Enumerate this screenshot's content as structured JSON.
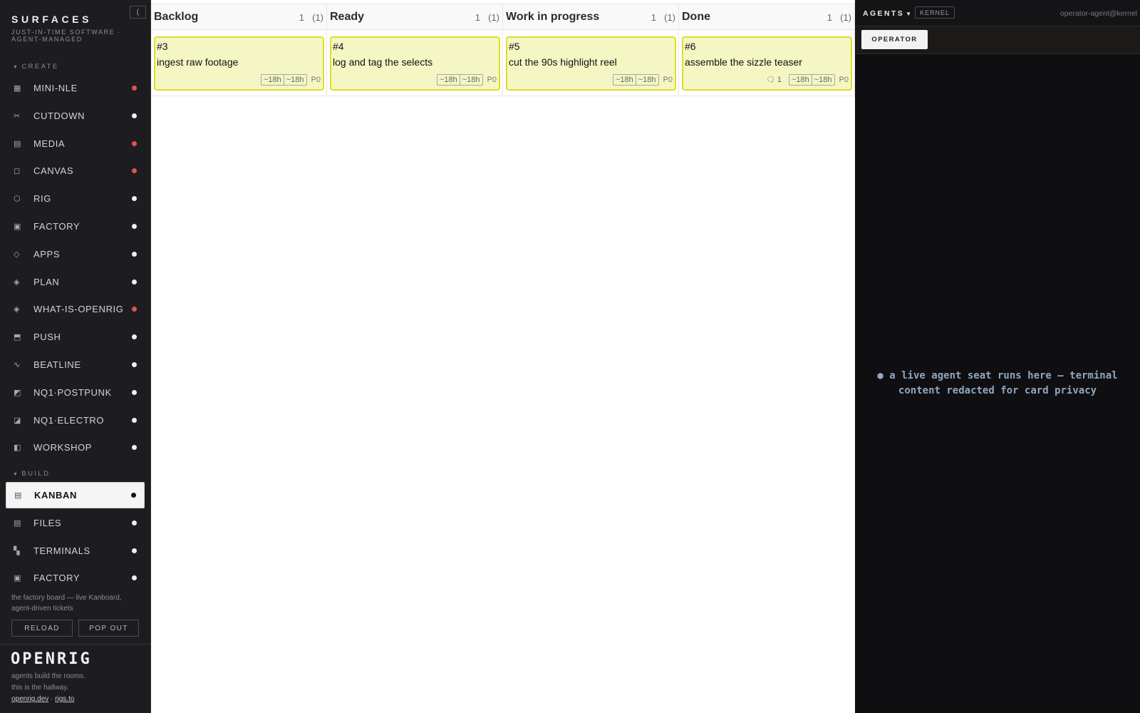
{
  "sidebar": {
    "collapse_icon": "(",
    "title": "SURFACES",
    "subtitle": "JUST-IN-TIME SOFTWARE · AGENT-MANAGED",
    "sections": {
      "create": {
        "label": "CREATE",
        "items": [
          {
            "label": "MINI-NLE",
            "icon": "▦",
            "icon_name": "grid-icon",
            "status": "red"
          },
          {
            "label": "CUTDOWN",
            "icon": "✂",
            "icon_name": "scissors-icon",
            "status": "white"
          },
          {
            "label": "MEDIA",
            "icon": "▤",
            "icon_name": "media-icon",
            "status": "red"
          },
          {
            "label": "CANVAS",
            "icon": "◻",
            "icon_name": "canvas-icon",
            "status": "red"
          },
          {
            "label": "RIG",
            "icon": "⬡",
            "icon_name": "hexagon-icon",
            "status": "white"
          },
          {
            "label": "FACTORY",
            "icon": "▣",
            "icon_name": "factory-icon",
            "status": "white"
          },
          {
            "label": "APPS",
            "icon": "◇",
            "icon_name": "diamond-icon",
            "status": "white"
          },
          {
            "label": "PLAN",
            "icon": "◈",
            "icon_name": "plan-icon",
            "status": "white"
          },
          {
            "label": "WHAT-IS-OPENRIG",
            "icon": "◈",
            "icon_name": "info-diamond-icon",
            "status": "red"
          },
          {
            "label": "PUSH",
            "icon": "⬒",
            "icon_name": "push-icon",
            "status": "white"
          },
          {
            "label": "BEATLINE",
            "icon": "∿",
            "icon_name": "wave-icon",
            "status": "white"
          },
          {
            "label": "NQ1·POSTPUNK",
            "icon": "◩",
            "icon_name": "postpunk-icon",
            "status": "white"
          },
          {
            "label": "NQ1·ELECTRO",
            "icon": "◪",
            "icon_name": "electro-icon",
            "status": "white"
          },
          {
            "label": "WORKSHOP",
            "icon": "◧",
            "icon_name": "workshop-icon",
            "status": "white"
          }
        ]
      },
      "build": {
        "label": "BUILD",
        "items": [
          {
            "label": "KANBAN",
            "icon": "▤",
            "icon_name": "kanban-icon",
            "status": "black",
            "active": true
          },
          {
            "label": "FILES",
            "icon": "▤",
            "icon_name": "files-icon",
            "status": "white"
          },
          {
            "label": "TERMINALS",
            "icon": "▚",
            "icon_name": "terminal-icon",
            "status": "white"
          },
          {
            "label": "FACTORY",
            "icon": "▣",
            "icon_name": "factory-icon",
            "status": "white"
          }
        ]
      }
    },
    "description": "the factory board — live Kanboard, agent-driven tickets",
    "reload_label": "RELOAD",
    "popout_label": "POP OUT",
    "logo": "OPENRIG",
    "tagline_1": "agents build the rooms.",
    "tagline_2": "this is the hallway.",
    "link_1": "openrig.dev",
    "link_sep": "·",
    "link_2": "rigs.to"
  },
  "colors": {
    "status_red": "#e5534b",
    "status_white": "#f0f0f0",
    "status_black": "#111111",
    "card_bg": "#f4f6c3",
    "card_border": "#dede2a"
  },
  "kanban": {
    "columns": [
      {
        "title": "Backlog",
        "count": "1",
        "limit": "(1)",
        "card": {
          "id": "#3",
          "title": "ingest raw footage",
          "estimate_1": "~18h",
          "estimate_2": "~18h",
          "priority": "P0",
          "comments": ""
        }
      },
      {
        "title": "Ready",
        "count": "1",
        "limit": "(1)",
        "card": {
          "id": "#4",
          "title": "log and tag the selects",
          "estimate_1": "~18h",
          "estimate_2": "~18h",
          "priority": "P0",
          "comments": ""
        }
      },
      {
        "title": "Work in progress",
        "count": "1",
        "limit": "(1)",
        "card": {
          "id": "#5",
          "title": "cut the 90s highlight reel",
          "estimate_1": "~18h",
          "estimate_2": "~18h",
          "priority": "P0",
          "comments": ""
        }
      },
      {
        "title": "Done",
        "count": "1",
        "limit": "(1)",
        "card": {
          "id": "#6",
          "title": "assemble the sizzle teaser",
          "estimate_1": "~18h",
          "estimate_2": "~18h",
          "priority": "P0",
          "comments": "1"
        }
      }
    ]
  },
  "agents": {
    "title": "AGENTS",
    "badge": "KERNEL",
    "user": "operator-agent@kernel",
    "tab_label": "OPERATOR",
    "message_line_1": "● a live agent seat runs here — terminal",
    "message_line_2": "content redacted for card privacy"
  }
}
